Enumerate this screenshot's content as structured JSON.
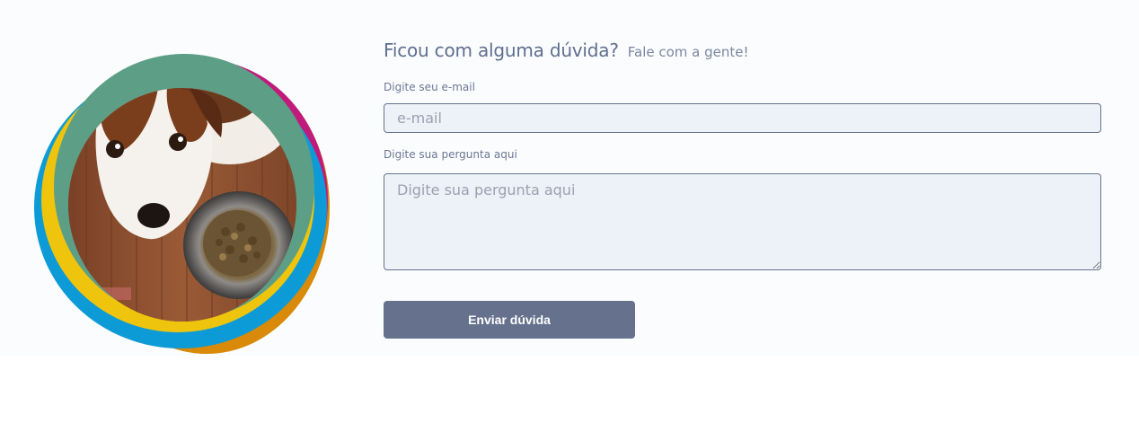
{
  "header": {
    "title": "Ficou com alguma dúvida?",
    "subtitle": "Fale com a gente!"
  },
  "form": {
    "email_label": "Digite seu e-mail",
    "email_placeholder": "e-mail",
    "question_label": "Digite sua pergunta aqui",
    "question_placeholder": "Digite sua pergunta aqui",
    "submit_label": "Enviar dúvida"
  },
  "colors": {
    "ring_green": "#5c9e86",
    "ring_yellow": "#efc40c",
    "ring_blue": "#0d9bd7",
    "ring_magenta": "#c01a7c",
    "ring_orange": "#d88a08",
    "button": "#66728d",
    "heading": "#5f6f8f"
  }
}
